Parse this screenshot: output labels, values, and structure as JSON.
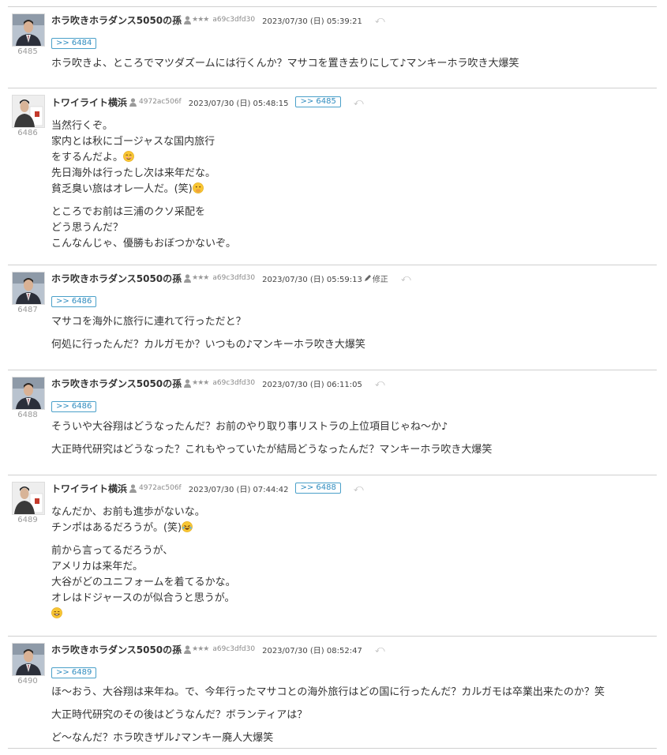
{
  "posts": [
    {
      "number": "6485",
      "author": "ホラ吹きホラダンス5050の孫",
      "stars": "★★★",
      "uid": "a69c3dfd30",
      "date": "2023/07/30 (日) 05:39:21",
      "edited_label": "",
      "anchor": ">> 6484",
      "anchor_position": "below",
      "avatar": "man-in-suit",
      "body": [
        [
          "ホラ吹きよ、ところでマツダズームには行くんか？マサコを置き去りにして♪マンキーホラ吹き大爆笑"
        ]
      ]
    },
    {
      "number": "6486",
      "author": "トワイライト横浜",
      "stars": "",
      "uid": "4972ac506f",
      "date": "2023/07/30 (日) 05:48:15",
      "edited_label": "",
      "anchor": ">> 6485",
      "anchor_position": "inline",
      "avatar": "man-with-banner",
      "body": [
        [
          "当然行くぞ。",
          "家内とは秋にゴージャスな国内旅行",
          "をするんだよ。",
          "先日海外は行ったし次は来年だな。",
          "貧乏臭い旅はオレ一人だ。(笑)"
        ],
        [
          "ところでお前は三浦のクソ采配を",
          "どう思うんだ？",
          "こんなんじゃ、優勝もおぼつかないぞ。"
        ]
      ]
    },
    {
      "number": "6487",
      "author": "ホラ吹きホラダンス5050の孫",
      "stars": "★★★",
      "uid": "a69c3dfd30",
      "date": "2023/07/30 (日) 05:59:13",
      "edited_label": "修正",
      "anchor": ">> 6486",
      "anchor_position": "below",
      "avatar": "man-in-suit",
      "body": [
        [
          "マサコを海外に旅行に連れて行っただと？"
        ],
        [
          "何処に行ったんだ？カルガモか？いつもの♪マンキーホラ吹き大爆笑"
        ]
      ]
    },
    {
      "number": "6488",
      "author": "ホラ吹きホラダンス5050の孫",
      "stars": "★★★",
      "uid": "a69c3dfd30",
      "date": "2023/07/30 (日) 06:11:05",
      "edited_label": "",
      "anchor": ">> 6486",
      "anchor_position": "below",
      "avatar": "man-in-suit",
      "body": [
        [
          "そういや大谷翔はどうなったんだ？お前のやり取り事リストラの上位項目じゃね～か♪"
        ],
        [
          "大正時代研究はどうなった？これもやっていたが結局どうなったんだ？マンキーホラ吹き大爆笑"
        ]
      ]
    },
    {
      "number": "6489",
      "author": "トワイライト横浜",
      "stars": "",
      "uid": "4972ac506f",
      "date": "2023/07/30 (日) 07:44:42",
      "edited_label": "",
      "anchor": ">> 6488",
      "anchor_position": "inline",
      "avatar": "man-with-banner",
      "body": [
        [
          "なんだか、お前も進歩がないな。",
          "チンポはあるだろうが。(笑)"
        ],
        [
          "前から言ってるだろうが、",
          "アメリカは来年だ。",
          "大谷がどのユニフォームを着てるかな。",
          "オレはドジャースのが似合うと思うが。",
          ""
        ]
      ]
    },
    {
      "number": "6490",
      "author": "ホラ吹きホラダンス5050の孫",
      "stars": "★★★",
      "uid": "a69c3dfd30",
      "date": "2023/07/30 (日) 08:52:47",
      "edited_label": "",
      "anchor": ">> 6489",
      "anchor_position": "below",
      "avatar": "man-in-suit",
      "body": [
        [
          "ほ～おう、大谷翔は来年ね。で、今年行ったマサコとの海外旅行はどの国に行ったんだ？カルガモは卒業出来たのか？笑"
        ],
        [
          "大正時代研究のその後はどうなんだ？ボランティアは？"
        ],
        [
          "ど～なんだ？ホラ吹きザル♪マンキー廃人大爆笑"
        ]
      ]
    }
  ]
}
